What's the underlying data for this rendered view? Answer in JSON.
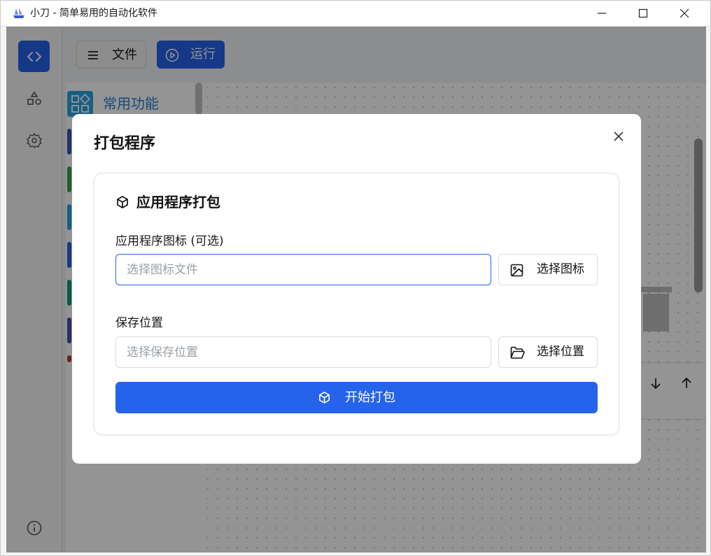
{
  "window": {
    "title": "小刀 - 简单易用的自动化软件",
    "minimize_icon": "minimize-icon",
    "maximize_icon": "maximize-icon",
    "close_icon": "close-icon"
  },
  "nav_rail": {
    "items": [
      {
        "name": "code",
        "icon": "code-brackets-icon",
        "active": true
      },
      {
        "name": "shapes",
        "icon": "shapes-icon",
        "active": false
      },
      {
        "name": "settings",
        "icon": "gear-icon",
        "active": false
      }
    ],
    "bottom_icon": "info-icon"
  },
  "toolbar": {
    "file_label": "文件",
    "run_label": "运行"
  },
  "function_panel": {
    "header_label": "常用功能"
  },
  "modal": {
    "title": "打包程序",
    "card_title": "应用程序打包",
    "icon_field": {
      "label": "应用程序图标 (可选)",
      "placeholder": "选择图标文件",
      "button_label": "选择图标"
    },
    "location_field": {
      "label": "保存位置",
      "placeholder": "选择保存位置",
      "button_label": "选择位置"
    },
    "start_button_label": "开始打包"
  },
  "colors": {
    "accent": "#2563eb",
    "overlay": "rgba(0,0,0,0.42)"
  }
}
